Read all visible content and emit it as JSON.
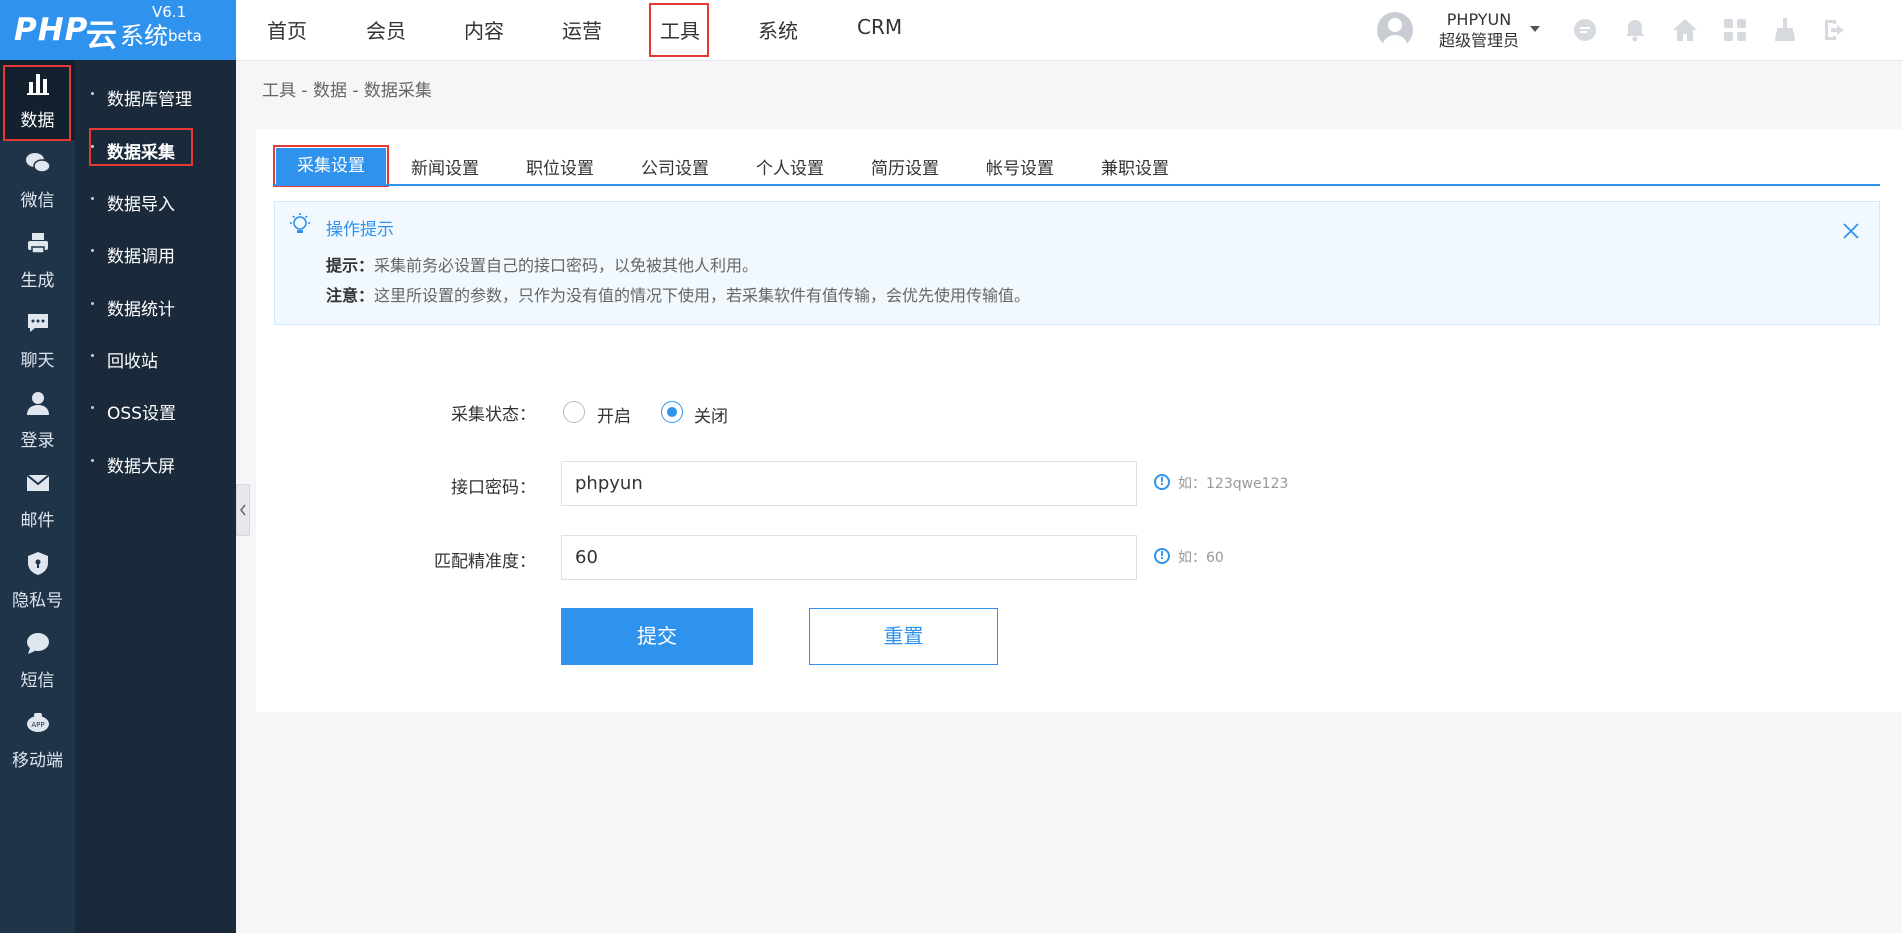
{
  "logo": {
    "brand": "PHP",
    "yun": "云",
    "system": "系统",
    "version": "V6.1",
    "beta": "beta"
  },
  "topnav": {
    "items": [
      "首页",
      "会员",
      "内容",
      "运营",
      "工具",
      "系统",
      "CRM"
    ],
    "active": "工具"
  },
  "user": {
    "name": "PHPYUN",
    "role": "超级管理员"
  },
  "header_icons": [
    "message-icon",
    "bell-icon",
    "home-icon",
    "grid-icon",
    "broom-icon",
    "logout-icon"
  ],
  "rail": [
    {
      "label": "数据",
      "icon": "bar-chart-icon",
      "active": true
    },
    {
      "label": "微信",
      "icon": "wechat-icon"
    },
    {
      "label": "生成",
      "icon": "printer-icon"
    },
    {
      "label": "聊天",
      "icon": "chat-icon"
    },
    {
      "label": "登录",
      "icon": "user-icon"
    },
    {
      "label": "邮件",
      "icon": "mail-icon"
    },
    {
      "label": "隐私号",
      "icon": "shield-icon"
    },
    {
      "label": "短信",
      "icon": "sms-icon"
    },
    {
      "label": "移动端",
      "icon": "app-icon"
    }
  ],
  "submenu": [
    {
      "label": "数据库管理"
    },
    {
      "label": "数据采集",
      "active": true
    },
    {
      "label": "数据导入"
    },
    {
      "label": "数据调用"
    },
    {
      "label": "数据统计"
    },
    {
      "label": "回收站"
    },
    {
      "label": "OSS设置"
    },
    {
      "label": "数据大屏"
    }
  ],
  "breadcrumb": "工具 - 数据 - 数据采集",
  "tabs": [
    "采集设置",
    "新闻设置",
    "职位设置",
    "公司设置",
    "个人设置",
    "简历设置",
    "帐号设置",
    "兼职设置"
  ],
  "tip": {
    "title": "操作提示",
    "line1_key": "提示：",
    "line1_text": "采集前务必设置自己的接口密码，以免被其他人利用。",
    "line2_key": "注意：",
    "line2_text": "这里所设置的参数，只作为没有值的情况下使用，若采集软件有值传输，会优先使用传输值。"
  },
  "form": {
    "status_label": "采集状态：",
    "status_on": "开启",
    "status_off": "关闭",
    "status_value": "关闭",
    "password_label": "接口密码：",
    "password_value": "phpyun",
    "password_hint": "如：123qwe123",
    "accuracy_label": "匹配精准度：",
    "accuracy_value": "60",
    "accuracy_hint": "如：60",
    "submit": "提交",
    "reset": "重置"
  },
  "colors": {
    "primary": "#2f93ee",
    "rail_bg": "#1f3448",
    "highlight": "#e53935"
  }
}
